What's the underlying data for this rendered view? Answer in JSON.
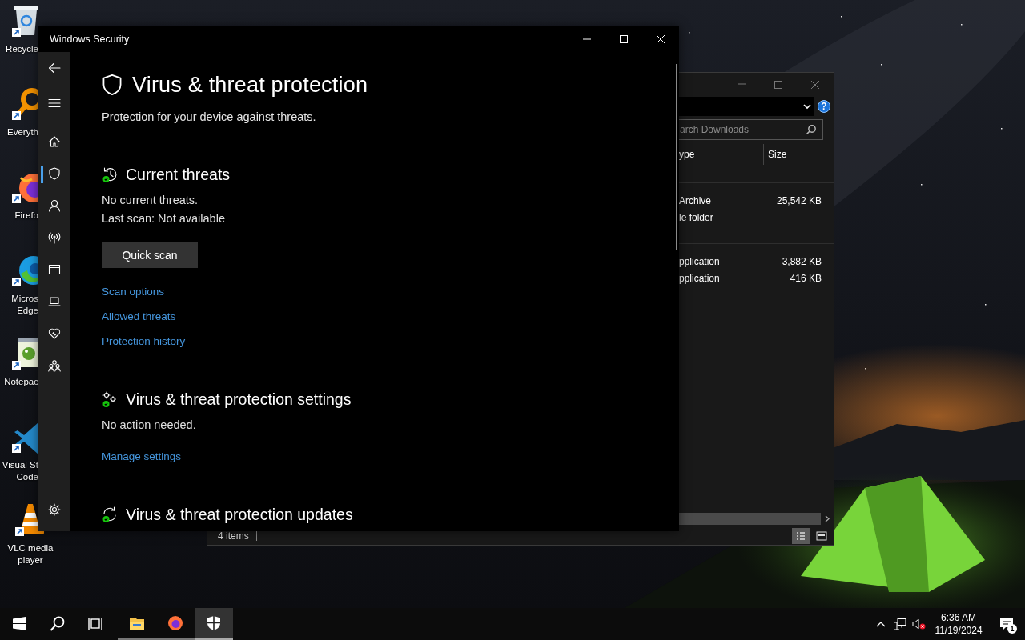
{
  "desktop": {
    "icons": [
      {
        "kind": "recycle-bin",
        "label": "Recycle"
      },
      {
        "kind": "search-tool",
        "label": "Everyth"
      },
      {
        "kind": "firefox",
        "label": "Firefo"
      },
      {
        "kind": "edge",
        "label": "Micros Edge"
      },
      {
        "kind": "notepad",
        "label": "Notepac"
      },
      {
        "kind": "code",
        "label": "Visual St Code"
      },
      {
        "kind": "vlc",
        "label": "VLC media player"
      }
    ]
  },
  "explorer": {
    "help": "?",
    "search": {
      "placeholder": "arch Downloads"
    },
    "columns": [
      "ype",
      "Size"
    ],
    "groups": [
      {
        "rows": [
          {
            "type": "Archive",
            "size": "25,542 KB"
          },
          {
            "type": "le folder"
          }
        ]
      },
      {
        "rows": [
          {
            "type": "pplication",
            "size": "3,882 KB"
          },
          {
            "type": "pplication",
            "size": "416 KB"
          }
        ]
      }
    ],
    "status": "4 items",
    "views": [
      {
        "kind": "details",
        "selected": true
      },
      {
        "kind": "tiles",
        "selected": false
      }
    ]
  },
  "security_window": {
    "title": "Windows Security",
    "nav": [
      {
        "kind": "back",
        "selected": false
      },
      {
        "kind": "menu",
        "selected": false
      },
      {
        "kind": "home",
        "selected": false
      },
      {
        "kind": "shield",
        "selected": true
      },
      {
        "kind": "account",
        "selected": false
      },
      {
        "kind": "network",
        "selected": false
      },
      {
        "kind": "app",
        "selected": false
      },
      {
        "kind": "device",
        "selected": false
      },
      {
        "kind": "health",
        "selected": false
      },
      {
        "kind": "family",
        "selected": false
      },
      {
        "kind": "settings",
        "selected": false
      }
    ],
    "heading": "Virus & threat protection",
    "subtitle": "Protection for your device against threats.",
    "sections": [
      {
        "kind": "history",
        "title": "Current threats",
        "lines": [
          "No current threats.",
          "Last scan: Not available"
        ],
        "button": "Quick scan",
        "links": [
          "Scan options",
          "Allowed threats",
          "Protection history"
        ]
      },
      {
        "kind": "gears",
        "title": "Virus & threat protection settings",
        "lines": [
          "No action needed."
        ],
        "links": [
          "Manage settings"
        ]
      },
      {
        "kind": "sync",
        "title": "Virus & threat protection updates"
      }
    ]
  },
  "taskbar": {
    "buttons": [
      {
        "kind": "start"
      },
      {
        "kind": "search"
      },
      {
        "kind": "task-view"
      }
    ],
    "apps": [
      {
        "kind": "folder",
        "selected": false
      },
      {
        "kind": "browser",
        "selected": false
      },
      {
        "kind": "security",
        "selected": true
      }
    ],
    "time": "6:36 AM",
    "date": "11/19/2024",
    "notifications": "1"
  }
}
